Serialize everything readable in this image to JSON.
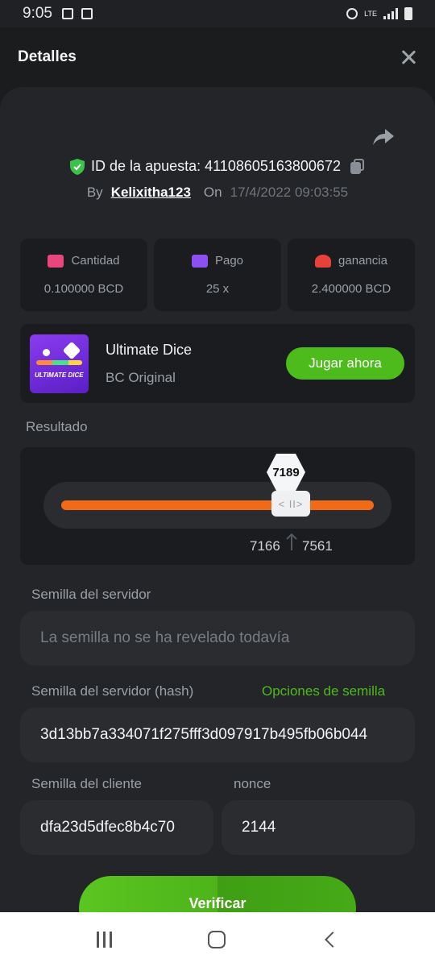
{
  "status_bar": {
    "time": "9:05",
    "network": "LTE"
  },
  "header": {
    "title": "Detalles"
  },
  "bet": {
    "id_label": "ID de la apuesta: 4110860516380067​2",
    "by_label": "By",
    "username": "Kelixitha123",
    "on_label": "On",
    "datetime": "17/4/2022 09:03:55"
  },
  "stats": [
    {
      "label": "Cantidad",
      "value": "0.100000 BCD",
      "icon": "coins-icon",
      "color": "#e8467c"
    },
    {
      "label": "Pago",
      "value": "25 x",
      "icon": "wallet-icon",
      "color": "#8d4ff0"
    },
    {
      "label": "ganancia",
      "value": "2.400000 BCD",
      "icon": "hand-coin-icon",
      "color": "#e8403a"
    }
  ],
  "game": {
    "name": "Ultimate Dice",
    "provider": "BC Original",
    "play_label": "Jugar ahora",
    "thumb_text": "ULTIMATE DICE"
  },
  "result": {
    "section_label": "Resultado",
    "value": "7189",
    "range_low": "7166",
    "range_high": "7561",
    "handle_glyph": "< II>"
  },
  "server_seed": {
    "label": "Semilla del servidor",
    "placeholder": "La semilla no se ha revelado todavía"
  },
  "server_seed_hash": {
    "label": "Semilla del servidor (hash)",
    "options_label": "Opciones de semilla",
    "value": "3d13bb7a334071f275fff3d097917b495fb06b044"
  },
  "client_seed": {
    "label": "Semilla del cliente",
    "value": "dfa23d5dfec8b4c70"
  },
  "nonce": {
    "label": "nonce",
    "value": "2144"
  },
  "verify_label": "Verificar",
  "colors": {
    "accent_green": "#4dbb1c",
    "slider_orange": "#f06a18",
    "panel": "#232529"
  }
}
